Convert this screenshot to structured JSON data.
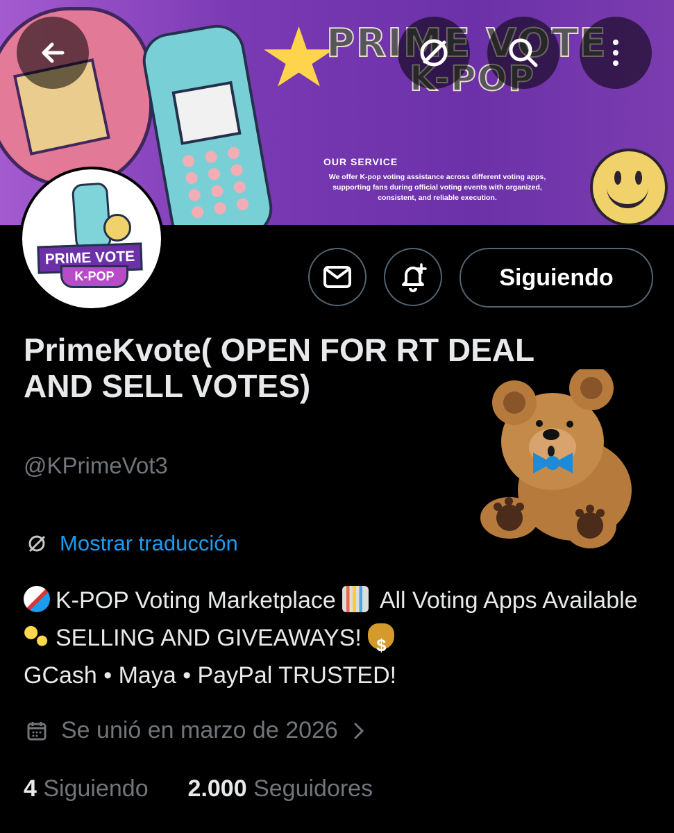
{
  "header": {
    "brand_line1": "PRIME VOTE",
    "brand_line2": "K-POP",
    "service_title": "OUR SERVICE",
    "service_text": "We offer K-pop voting assistance across different voting apps, supporting fans during official voting events with organized, consistent, and reliable execution."
  },
  "profile": {
    "avatar_line1": "PRIME VOTE",
    "avatar_line2": "K-POP",
    "name": "PrimeKvote( OPEN FOR RT DEAL AND SELL VOTES)",
    "handle": "@KPrimeVot3",
    "translation": "Mostrar traducción",
    "bio": {
      "part1": "K-POP Voting Marketplace ",
      "part2": " All Voting Apps Available ",
      "part3": "SELLING AND GIVEAWAYS! ",
      "part4": "GCash • Maya • PayPal   TRUSTED!"
    },
    "joined": "Se unió en marzo de 2026",
    "following_count": "4",
    "following_label": "Siguiendo",
    "followers_count": "2.000",
    "followers_label": "Seguidores"
  },
  "actions": {
    "following_button": "Siguiendo"
  },
  "colors": {
    "accent": "#1d9bf0",
    "background": "#000000"
  },
  "icons": [
    "back-arrow-icon",
    "translate-icon",
    "search-icon",
    "more-vertical-icon",
    "message-icon",
    "notification-add-icon",
    "calendar-icon",
    "chevron-right-icon"
  ]
}
